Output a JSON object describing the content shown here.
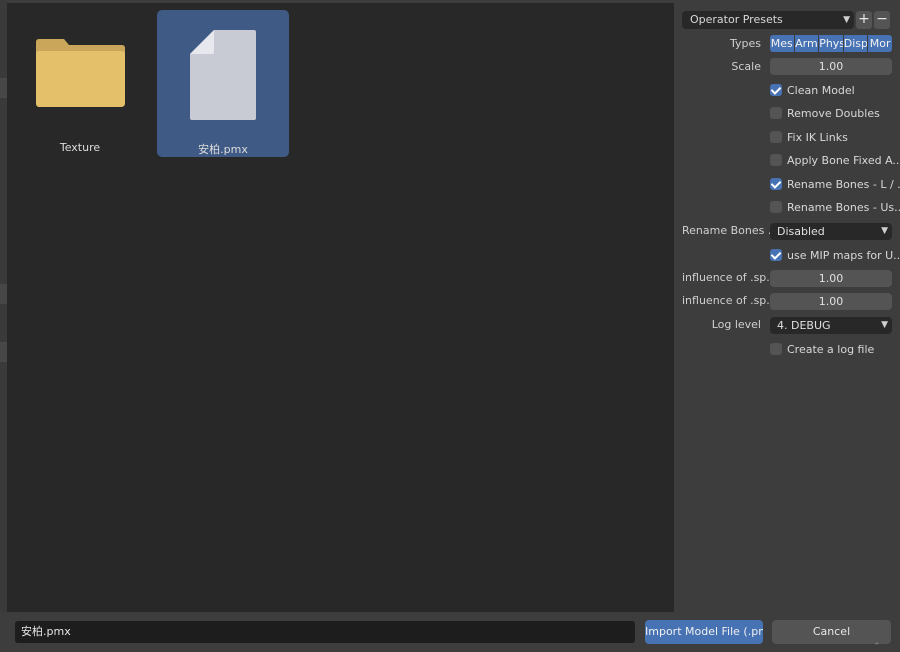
{
  "files": [
    {
      "name": "Texture",
      "kind": "folder"
    },
    {
      "name": "安柏.pmx",
      "kind": "file",
      "selected": true
    }
  ],
  "sidebar": {
    "preset_label": "Operator Presets",
    "preset_add": "+",
    "preset_remove": "−",
    "types_label": "Types",
    "types": [
      "Mes",
      "Arm",
      "Phys",
      "Disp",
      "Mor"
    ],
    "scale_label": "Scale",
    "scale_value": "1.00",
    "checks": [
      {
        "label": "Clean Model",
        "checked": true
      },
      {
        "label": "Remove Doubles",
        "checked": false
      },
      {
        "label": "Fix IK Links",
        "checked": false
      },
      {
        "label": "Apply Bone Fixed A...",
        "checked": false
      },
      {
        "label": "Rename Bones - L / ...",
        "checked": true
      },
      {
        "label": "Rename Bones - Us...",
        "checked": false
      }
    ],
    "rename_label": "Rename Bones ...",
    "rename_value": "Disabled",
    "mip_label": "use MIP maps for U...",
    "mip_checked": true,
    "influence1_label": "influence of .sp...",
    "influence1_value": "1.00",
    "influence2_label": "influence of .sp...",
    "influence2_value": "1.00",
    "log_label": "Log level",
    "log_value": "4. DEBUG",
    "logfile_label": "Create a log file",
    "logfile_checked": false
  },
  "bottom": {
    "filename": "安柏.pmx",
    "import_label": "Import Model File (.pm...",
    "cancel_label": "Cancel"
  },
  "colors": {
    "accent": "#4772b3",
    "selection": "#3f5a85",
    "folder": "#e5c06b",
    "panel": "#3d3d3d",
    "file_area": "#282828"
  }
}
